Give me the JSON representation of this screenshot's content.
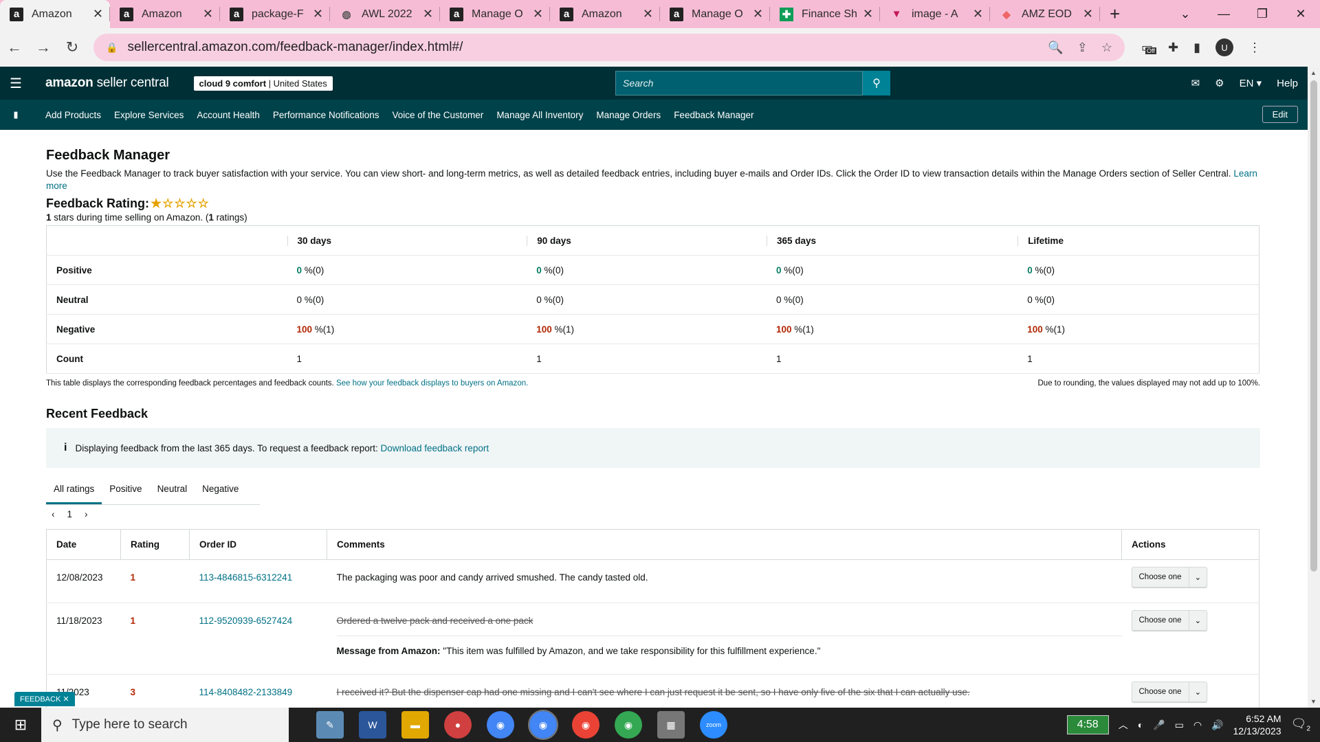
{
  "browser": {
    "tabs": [
      {
        "title": "Amazon",
        "icon": "amazon-icon",
        "active": true
      },
      {
        "title": "Amazon",
        "icon": "amazon-icon"
      },
      {
        "title": "package-F",
        "icon": "amazon-icon"
      },
      {
        "title": "AWL 2022",
        "icon": "globe-icon"
      },
      {
        "title": "Manage O",
        "icon": "amazon-icon"
      },
      {
        "title": "Amazon",
        "icon": "amazon-icon"
      },
      {
        "title": "Manage O",
        "icon": "amazon-icon"
      },
      {
        "title": "Finance Sh",
        "icon": "sheets-icon"
      },
      {
        "title": "image - A",
        "icon": "image-icon"
      },
      {
        "title": "AMZ EOD",
        "icon": "app-icon"
      }
    ],
    "url": "sellercentral.amazon.com/feedback-manager/index.html#/",
    "profile": "U",
    "ext_badge": "Off"
  },
  "header": {
    "logo_a": "amazon",
    "logo_b": " seller central",
    "store": "cloud 9 comfort",
    "marketplace": "United States",
    "search_placeholder": "Search",
    "lang": "EN",
    "help": "Help"
  },
  "nav": {
    "items": [
      "Add Products",
      "Explore Services",
      "Account Health",
      "Performance Notifications",
      "Voice of the Customer",
      "Manage All Inventory",
      "Manage Orders",
      "Feedback Manager"
    ],
    "edit": "Edit"
  },
  "page": {
    "title": "Feedback Manager",
    "description": "Use the Feedback Manager to track buyer satisfaction with your service. You can view short- and long-term metrics, as well as detailed feedback entries, including buyer e-mails and Order IDs. Click the Order ID to view transaction details within the Manage Orders section of Seller Central.",
    "learn_more": "Learn more",
    "rating_label": "Feedback Rating:",
    "rating_stars": 1,
    "rating_sub_a": "1",
    "rating_sub_b": " stars during time selling on Amazon. (",
    "rating_sub_c": "1",
    "rating_sub_d": " ratings)"
  },
  "metrics": {
    "columns": [
      "30 days",
      "90 days",
      "365 days",
      "Lifetime"
    ],
    "rows": [
      {
        "label": "Positive",
        "cells": [
          [
            "0",
            " %(0)"
          ],
          [
            "0",
            " %(0)"
          ],
          [
            "0",
            " %(0)"
          ],
          [
            "0",
            " %(0)"
          ]
        ]
      },
      {
        "label": "Neutral",
        "cells": [
          [
            "0",
            " %(0)"
          ],
          [
            "0",
            " %(0)"
          ],
          [
            "0",
            " %(0)"
          ],
          [
            "0",
            " %(0)"
          ]
        ]
      },
      {
        "label": "Negative",
        "cells": [
          [
            "100",
            " %(1)"
          ],
          [
            "100",
            " %(1)"
          ],
          [
            "100",
            " %(1)"
          ],
          [
            "100",
            " %(1)"
          ]
        ]
      },
      {
        "label": "Count",
        "cells": [
          [
            "1",
            ""
          ],
          [
            "1",
            ""
          ],
          [
            "1",
            ""
          ],
          [
            "1",
            ""
          ]
        ]
      }
    ],
    "note_left": "This table displays the corresponding feedback percentages and feedback counts.",
    "note_link": "See how your feedback displays to buyers on Amazon.",
    "note_right": "Due to rounding, the values displayed may not add up to 100%."
  },
  "recent": {
    "title": "Recent Feedback",
    "info": "Displaying feedback from the last 365 days. To request a feedback report:",
    "info_link": "Download feedback report",
    "tabs": [
      "All ratings",
      "Positive",
      "Neutral",
      "Negative"
    ],
    "page": "1",
    "headers": [
      "Date",
      "Rating",
      "Order ID",
      "Comments",
      "Actions"
    ],
    "rows": [
      {
        "date": "12/08/2023",
        "rating": "1",
        "order": "113-4846815-6312241",
        "comment": "The packaging was poor and candy arrived smushed. The candy tasted old.",
        "action": "Choose one"
      },
      {
        "date": "11/18/2023",
        "rating": "1",
        "order": "112-9520939-6527424",
        "comment": "Ordered a twelve pack and received a one pack",
        "action": "Choose one",
        "msg_label": "Message from Amazon:",
        "msg": " \"This item was fulfilled by Amazon, and we take responsibility for this fulfillment experience.\""
      },
      {
        "date": "11/2023",
        "rating": "3",
        "order": "114-8408482-2133849",
        "comment": "I received it? But the dispenser cap had one missing and I can't see where I can just request it be sent, so I have only five of the six that I can actually use.",
        "action": "Choose one"
      }
    ],
    "feedback_tab": "FEEDBACK"
  },
  "taskbar": {
    "search": "Type here to search",
    "timer": "4:58",
    "time": "6:52 AM",
    "date": "12/13/2023",
    "notif": "2"
  }
}
